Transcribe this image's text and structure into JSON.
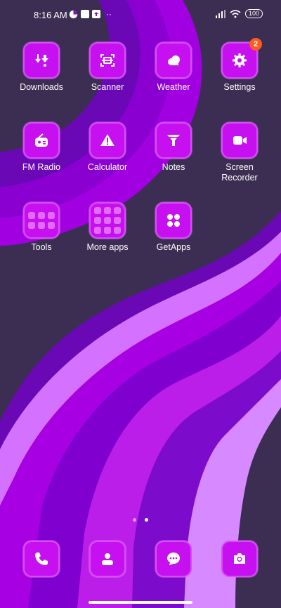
{
  "status_bar": {
    "time": "8:16 AM",
    "battery": "100"
  },
  "apps": [
    {
      "label": "Downloads",
      "icon": "download-icon"
    },
    {
      "label": "Scanner",
      "icon": "scanner-icon"
    },
    {
      "label": "Weather",
      "icon": "cloud-icon"
    },
    {
      "label": "Settings",
      "icon": "gear-icon",
      "badge": "2"
    },
    {
      "label": "FM Radio",
      "icon": "radio-icon"
    },
    {
      "label": "Calculator",
      "icon": "calculator-icon"
    },
    {
      "label": "Notes",
      "icon": "funnel-icon"
    },
    {
      "label": "Screen Recorder",
      "icon": "video-camera-icon"
    },
    {
      "label": "Tools",
      "icon": "folder-icon"
    },
    {
      "label": "More apps",
      "icon": "folder-icon"
    },
    {
      "label": "GetApps",
      "icon": "four-dots-icon"
    }
  ],
  "dock": [
    {
      "icon": "phone-icon"
    },
    {
      "icon": "contacts-icon"
    },
    {
      "icon": "message-icon"
    },
    {
      "icon": "camera-icon"
    }
  ],
  "colors": {
    "accent": "#c610f0",
    "badge": "#ff5a1f"
  }
}
